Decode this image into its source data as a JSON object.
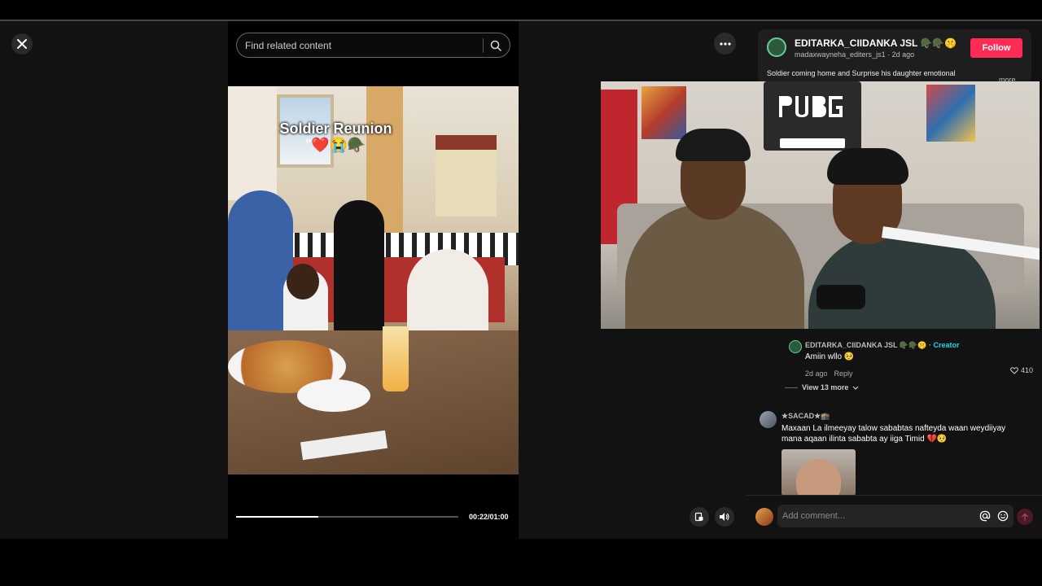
{
  "search": {
    "placeholder": "Find related content"
  },
  "video": {
    "caption_title": "Soldier Reunion",
    "caption_emoji": "\"❤️😭🪖",
    "time": "00:22/01:00",
    "progress": 0.37
  },
  "author": {
    "name": "EDITARKA_CIIDANKA JSL 🪖🪖🤫",
    "handle": "madaxwayneha_editers_js1 · 2d ago",
    "follow_label": "Follow",
    "description": "Soldier coming home and Surprise his daughter emotional #soldiercominghome #greatmomentsinsights",
    "more_label": "more"
  },
  "comments": [
    {
      "author": "EDITARKA_CIIDANKA JSL 🪖🪖🤫",
      "badge": "· Creator",
      "text": "Amiin wllo 🥺",
      "time": "2d ago",
      "reply_label": "Reply",
      "likes": "410"
    },
    {
      "author": "★SACAD★🕋",
      "text": "Maxaan La ilmeeyay talow sababtas nafteyda waan weydiiyay mana aqaan ilinta sababta ay iiga Timid 💔🥺"
    }
  ],
  "view_more_label": "View 13 more",
  "comment_input": {
    "placeholder": "Add comment..."
  },
  "colors": {
    "follow": "#fe2c55",
    "creator": "#20d5ec",
    "background": "#121212"
  }
}
